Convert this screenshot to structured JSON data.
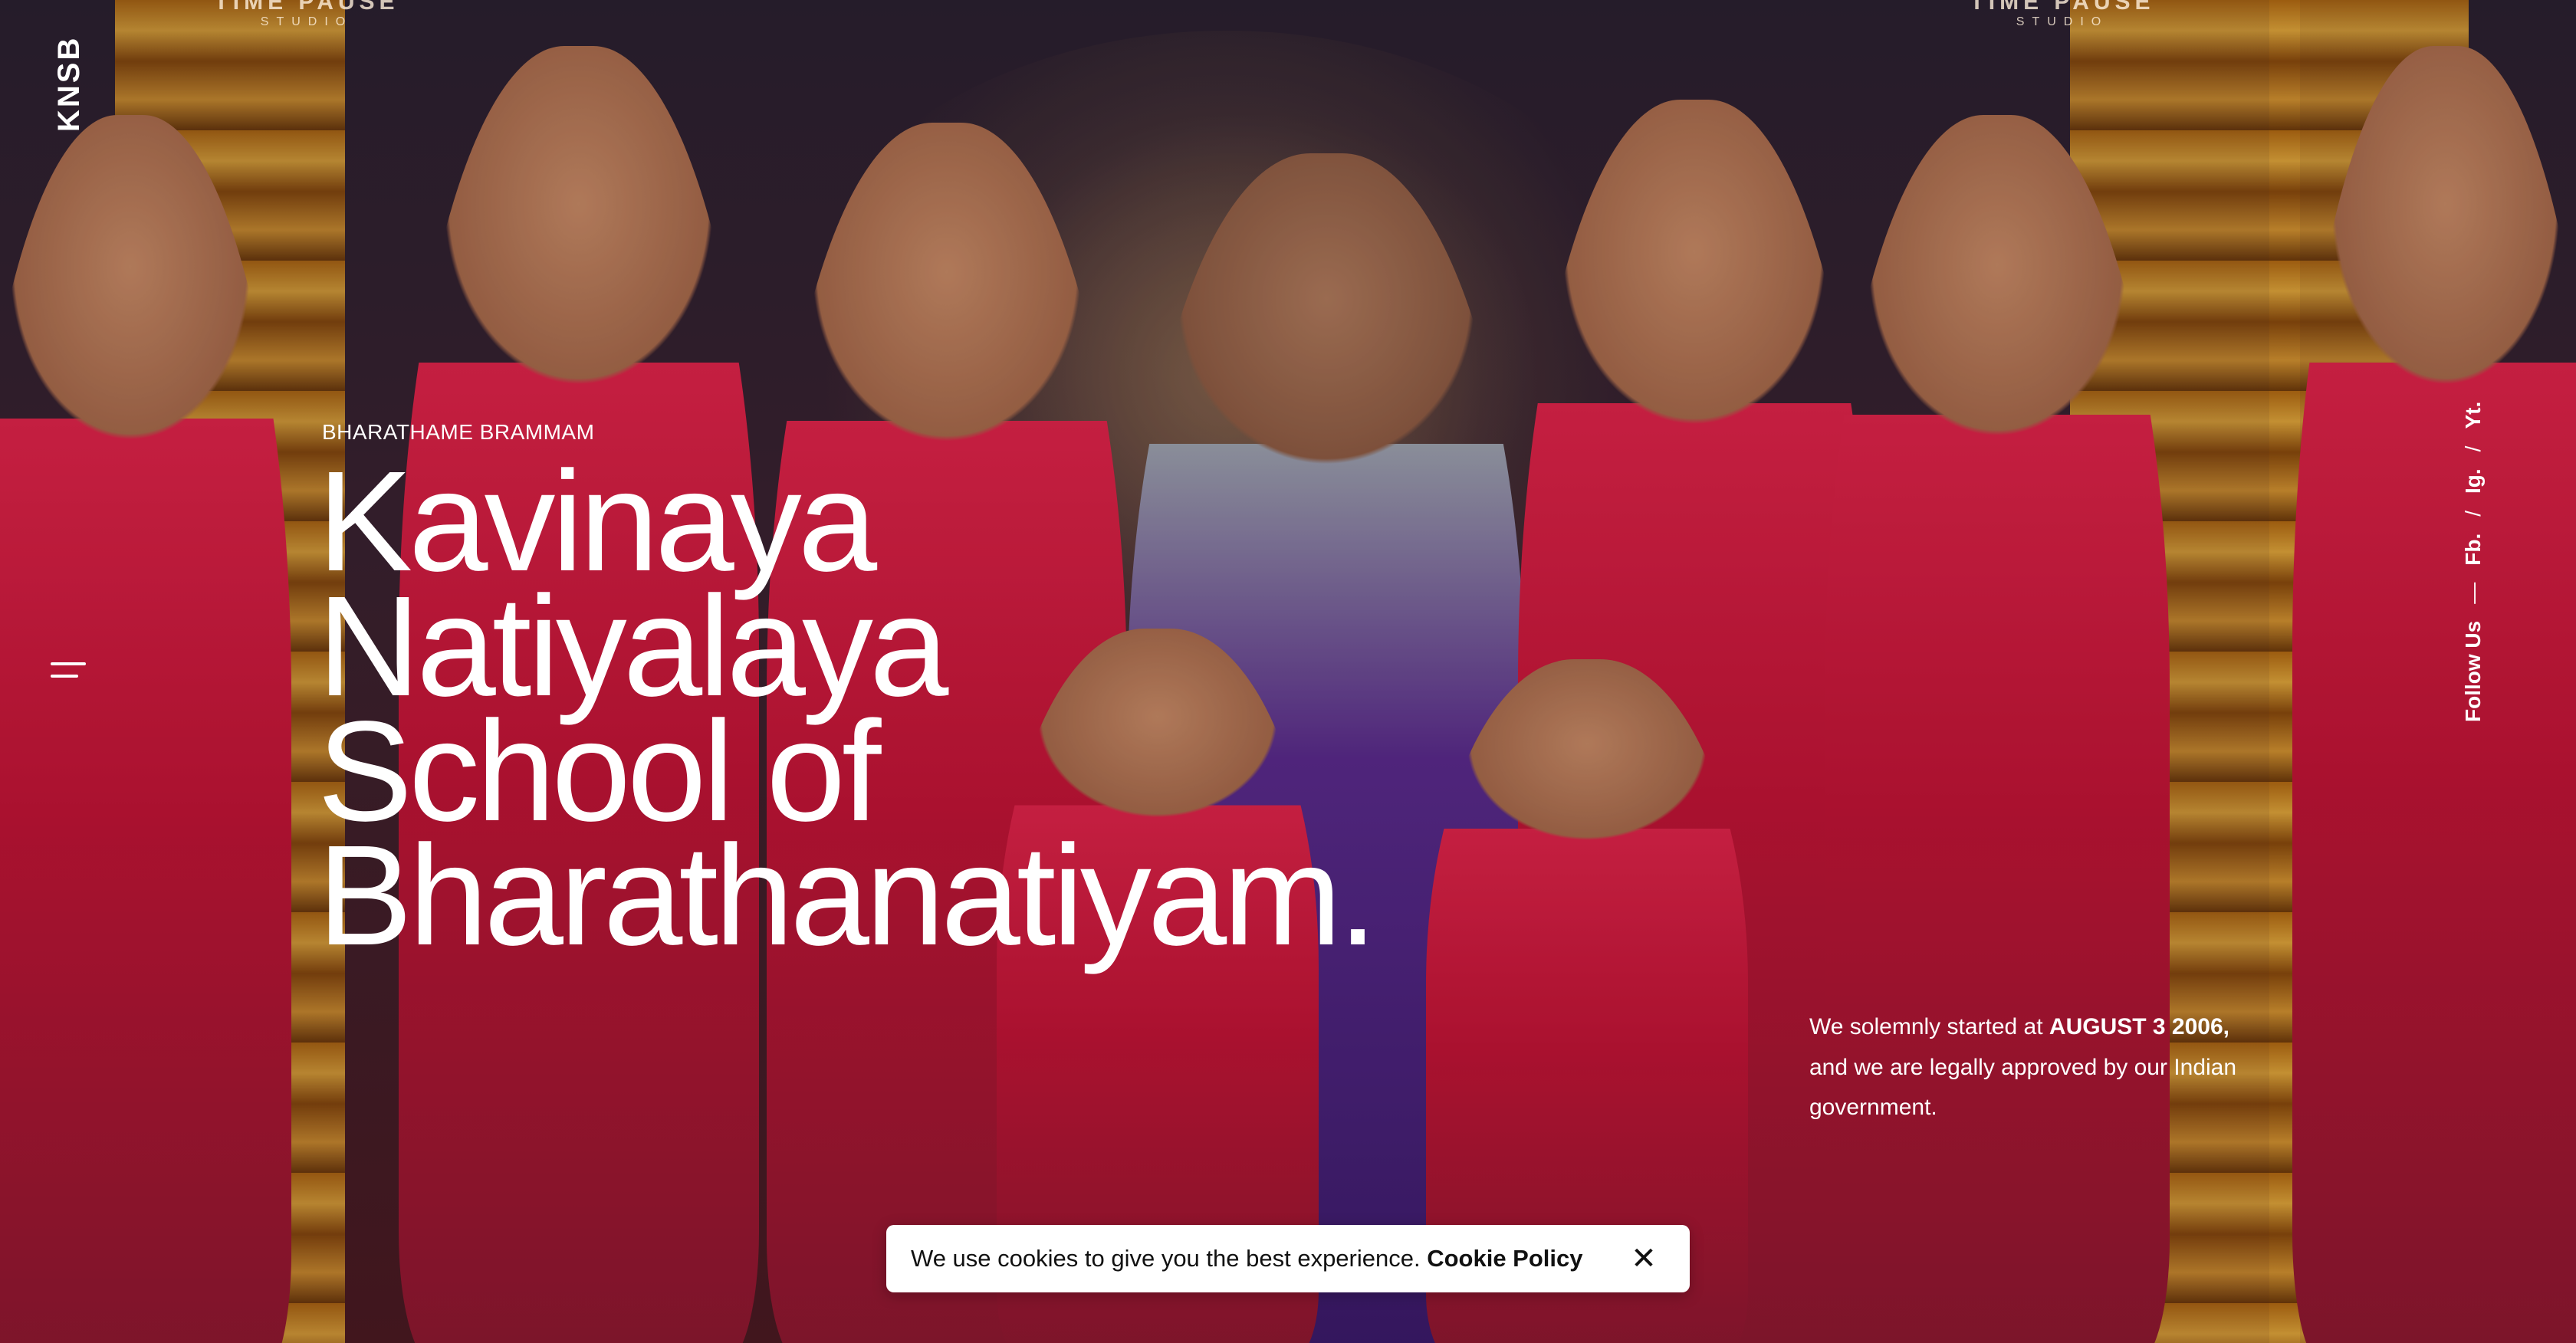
{
  "brand": {
    "logo_text": "KNSB",
    "watermark": "TIME PAUSE",
    "watermark_sub": "STUDIO"
  },
  "hero": {
    "eyebrow": "BHARATHAME BRAMMAM",
    "title_lines": [
      "Kavinaya",
      "Natiyalaya",
      "School of",
      "Bharathanatiyam."
    ]
  },
  "intro": {
    "before": "We solemnly started at ",
    "date": "AUGUST 3 2006,",
    "after": " and we are legally approved by our Indian government."
  },
  "social": {
    "label": "Follow Us",
    "dash": "—",
    "links": [
      "Fb.",
      "Ig.",
      "Yt."
    ],
    "sep": "/"
  },
  "cookie": {
    "message": "We use cookies to give you the best experience. ",
    "policy_link": "Cookie Policy",
    "close_symbol": "✕"
  },
  "icons": {
    "menu": "menu-icon",
    "close": "close-icon"
  },
  "colors": {
    "accent_red": "#e0244a",
    "gold": "#e0a53a",
    "text": "#ffffff"
  }
}
